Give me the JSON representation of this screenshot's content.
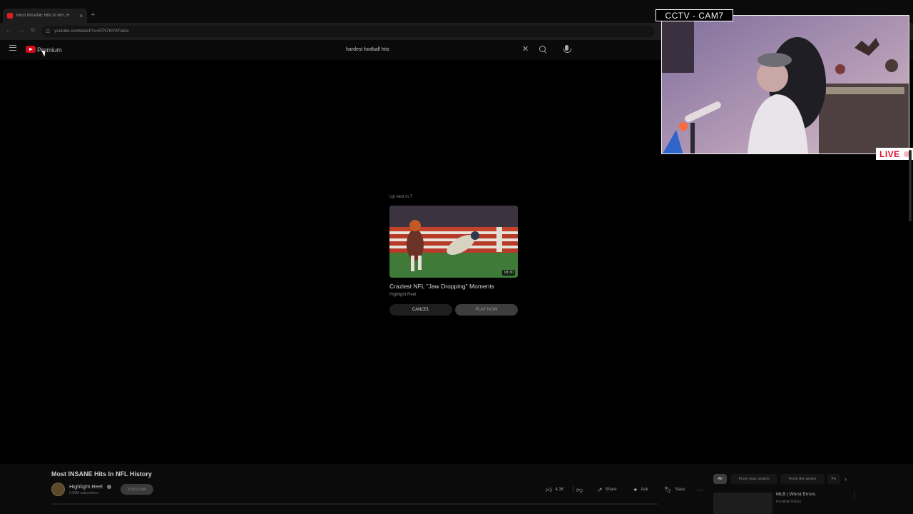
{
  "browser": {
    "tab_title": "Most INSANE Hits In NFL H",
    "new_tab": "+",
    "url": "youtube.com/watch?v=5TN7HVXFwDo"
  },
  "youtube_header": {
    "brand": "Premium",
    "search_query": "hardest football hits"
  },
  "up_next": {
    "label": "Up next in 7",
    "title": "Craziest NFL \"Jaw Dropping\" Moments",
    "channel": "Highlight Reel",
    "duration": "18:30",
    "cancel_label": "CANCEL",
    "play_now_label": "PLAY NOW"
  },
  "webcam": {
    "label": "CCTV - CAM7",
    "live_label": "LIVE"
  },
  "video": {
    "title": "Most INSANE Hits In NFL History",
    "channel": "Highlight Reel",
    "subscribers": "3.96M subscribers",
    "subscribe_label": "Subscribe",
    "likes": "4.3K",
    "share_label": "Share",
    "ask_label": "Ask",
    "save_label": "Save"
  },
  "sidebar": {
    "chips": [
      "All",
      "From your search",
      "From the series",
      "Fo"
    ],
    "recommendation": {
      "title": "MLB | Worst Errors",
      "channel": "Football Flicks"
    }
  },
  "colors": {
    "accent_red": "#d10d1d",
    "live_red": "#e0112b"
  }
}
